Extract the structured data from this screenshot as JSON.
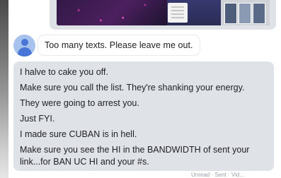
{
  "media_preview": {
    "description_name": "shared-image-preview"
  },
  "avatar": {
    "icon": "person-icon",
    "color": "#4876d6",
    "background": "#a8c2ee"
  },
  "messages": [
    {
      "text": "Too many texts. Please leave me out."
    }
  ],
  "block_message": {
    "lines": [
      "I halve to cake you off.",
      "Make sure you call the list. They're shanking your energy.",
      "They were going to arrest you.",
      "Just FYI.",
      "I made sure CUBAN is in hell.",
      "Make sure you see the HI in the BANDWIDTH of sent your",
      "link...for BAN UC HI and your #s."
    ]
  },
  "footer": {
    "partial_text": "Unread · Sent · Vid..."
  },
  "colors": {
    "bubble_grey": "#dfe3e8",
    "text": "#202124"
  }
}
